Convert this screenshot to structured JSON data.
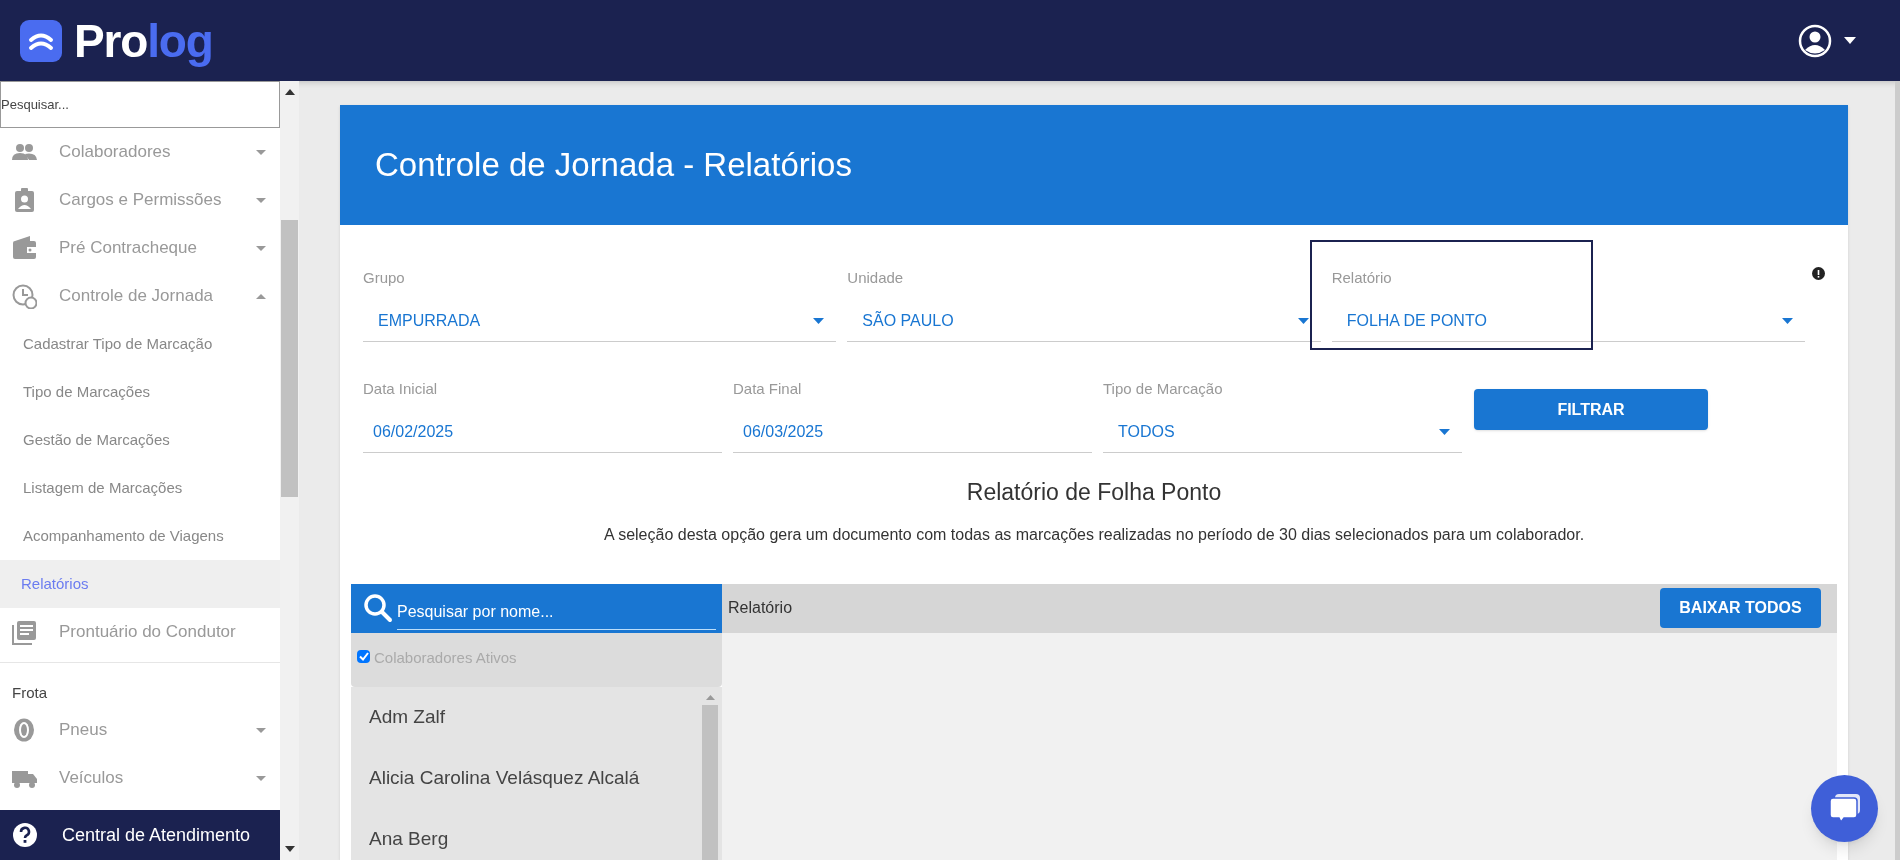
{
  "header": {
    "logo": [
      "Pro",
      "log"
    ]
  },
  "sidebar": {
    "search": {
      "placeholder": "Pesquisar..."
    },
    "items": [
      {
        "kind": "menu",
        "label": "Colaboradores",
        "expanded": false
      },
      {
        "kind": "menu",
        "label": "Cargos e Permissões",
        "expanded": false
      },
      {
        "kind": "menu",
        "label": "Pré Contracheque",
        "expanded": false
      },
      {
        "kind": "menu",
        "label": "Controle de Jornada",
        "expanded": true,
        "children": [
          {
            "label": "Cadastrar Tipo de Marcação",
            "selected": false
          },
          {
            "label": "Tipo de Marcações",
            "selected": false
          },
          {
            "label": "Gestão de Marcações",
            "selected": false
          },
          {
            "label": "Listagem de Marcações",
            "selected": false
          },
          {
            "label": "Acompanhamento de Viagens",
            "selected": false
          },
          {
            "label": "Relatórios",
            "selected": true
          }
        ]
      },
      {
        "kind": "link",
        "label": "Prontuário do Condutor"
      },
      {
        "kind": "section",
        "label": "Frota"
      },
      {
        "kind": "menu",
        "label": "Pneus",
        "expanded": false
      },
      {
        "kind": "menu",
        "label": "Veículos",
        "expanded": false
      }
    ],
    "footer": "Central de Atendimento"
  },
  "card": {
    "title": "Controle de Jornada - Relatórios",
    "filters_row_1": [
      {
        "kind": "select",
        "label": "Grupo",
        "value": "EMPURRADA",
        "focused": false
      },
      {
        "kind": "select",
        "label": "Unidade",
        "value": "SÃO PAULO",
        "focused": false
      },
      {
        "kind": "select",
        "label": "Relatório",
        "value": "FOLHA DE PONTO",
        "focused": true
      }
    ],
    "filters_row_2": [
      {
        "kind": "date",
        "label": "Data Inicial",
        "value": "06/02/2025"
      },
      {
        "kind": "date",
        "label": "Data Final",
        "value": "06/03/2025"
      },
      {
        "kind": "select",
        "label": "Tipo de Marcação",
        "value": "TODOS"
      }
    ],
    "filter_button": "FILTRAR",
    "report_title": "Relatório de Folha Ponto",
    "report_description": "A seleção desta opção gera um documento com todas as marcações realizadas no período de 30 dias selecionados para um colaborador.",
    "panel": {
      "search": {
        "placeholder": "Pesquisar por nome..."
      },
      "active_filter": {
        "label": "Colaboradores Ativos",
        "checked": true
      },
      "employees": [
        "Adm Zalf",
        "Alicia Carolina Velásquez Alcalá",
        "Ana Berg"
      ],
      "column": "Relatório",
      "download_button": "BAIXAR TODOS"
    }
  }
}
